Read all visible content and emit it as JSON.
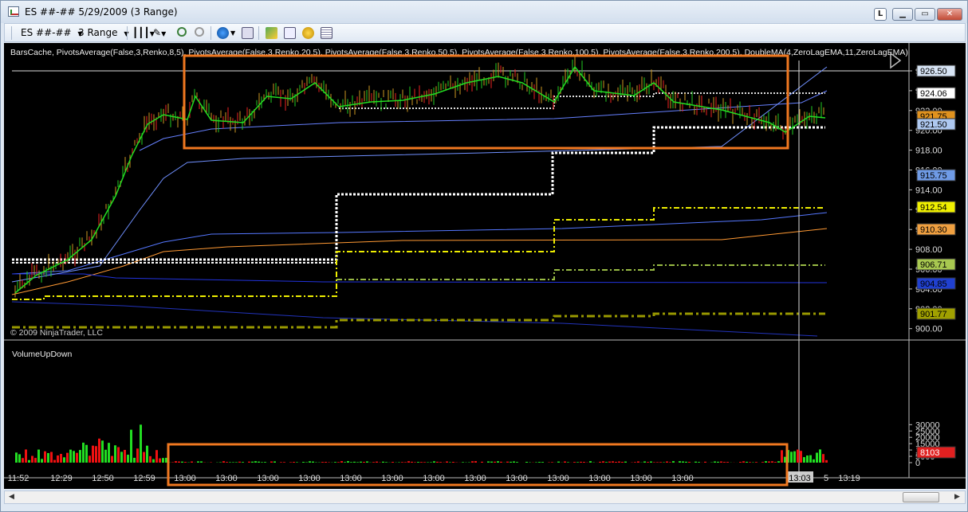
{
  "window": {
    "title": "ES ##-##  5/29/2009 (3 Range)",
    "l_button": "L"
  },
  "toolbar": {
    "instrument": "ES ##-##",
    "period": "3 Range",
    "icons": [
      "bar-type-icon",
      "draw-pen-icon",
      "zoom-in-icon",
      "zoom-out-icon",
      "globe-icon",
      "properties-icon",
      "strategy-icon",
      "chart-trader-icon",
      "gold-coin-icon",
      "data-box-icon"
    ]
  },
  "chart": {
    "indicator_label": "BarsCache, PivotsAverage(False,3,Renko,8,5), PivotsAverage(False,3,Renko,20,5), PivotsAverage(False,3,Renko,50,5), PivotsAverage(False,3,Renko,100,5), PivotsAverage(False,3,Renko,200,5), DoubleMA(4,ZeroLagEMA,11,ZeroLagEMA)",
    "copyright": "© 2009 NinjaTrader, LLC",
    "volume_label": "VolumeUpDown",
    "price_ticks": [
      "926.00",
      "924.00",
      "922.00",
      "920.00",
      "918.00",
      "916.00",
      "914.00",
      "912.00",
      "910.00",
      "908.00",
      "906.00",
      "904.00",
      "902.00",
      "900.00"
    ],
    "price_tags": [
      {
        "text": "926.50",
        "color": "#d7e4f5"
      },
      {
        "text": "924.06",
        "color": "#ffffff"
      },
      {
        "text": "921.75",
        "color": "#e0921e"
      },
      {
        "text": "921.50",
        "color": "#aec8f0"
      },
      {
        "text": "915.75",
        "color": "#6f9be6"
      },
      {
        "text": "912.54",
        "color": "#f0f000"
      },
      {
        "text": "910.30",
        "color": "#f0a040"
      },
      {
        "text": "906.71",
        "color": "#a8c850"
      },
      {
        "text": "904.85",
        "color": "#2040d0"
      },
      {
        "text": "901.77",
        "color": "#a0a000"
      }
    ],
    "volume_ticks": [
      "30000",
      "25000",
      "20000",
      "15000",
      "10000",
      "5000",
      "0"
    ],
    "volume_tag": {
      "text": "8103",
      "color": "#e02020"
    },
    "time_labels": [
      "11:52",
      "12:29",
      "12:50",
      "12:59",
      "13:00",
      "13:00",
      "13:00",
      "13:00",
      "13:00",
      "13:00",
      "13:00",
      "13:00",
      "13:00",
      "13:00",
      "13:00",
      "13:00",
      "13:00",
      "13:03",
      "5",
      "13:19"
    ]
  },
  "colors": {
    "up": "#22dd22",
    "down": "#ee1111",
    "highlight": "#f07820"
  }
}
